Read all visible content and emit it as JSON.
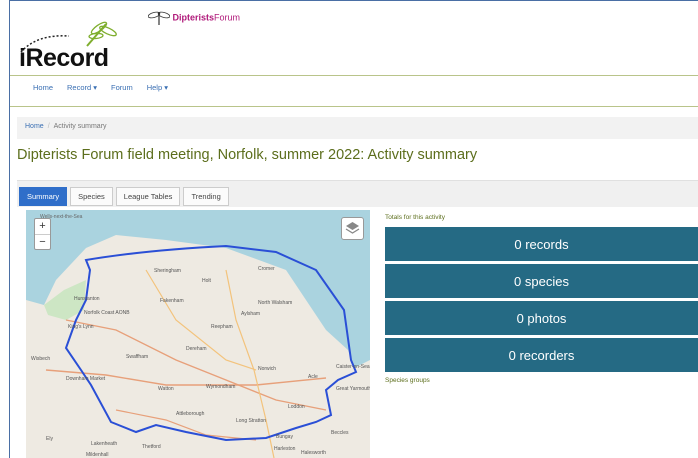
{
  "header": {
    "logo_text": "iRecord",
    "partner_name_bold": "Dipterists",
    "partner_name_rest": "Forum"
  },
  "nav": {
    "items": [
      "Home",
      "Record ▾",
      "Forum",
      "Help ▾"
    ]
  },
  "breadcrumb": {
    "home": "Home",
    "separator": "/",
    "current": "Activity summary"
  },
  "page": {
    "title": "Dipterists Forum field meeting, Norfolk, summer 2022: Activity summary"
  },
  "tabs": [
    {
      "label": "Summary",
      "active": true
    },
    {
      "label": "Species",
      "active": false
    },
    {
      "label": "League Tables",
      "active": false
    },
    {
      "label": "Trending",
      "active": false
    }
  ],
  "map": {
    "zoom_in": "+",
    "zoom_out": "−",
    "boundary_color": "#2a4fd6",
    "place_labels": [
      "Wells-next-the-Sea",
      "Sheringham",
      "Cromer",
      "Hunstanton",
      "Norfolk Coast AONB",
      "Fakenham",
      "North Walsham",
      "Aylsham",
      "King's Lynn",
      "Reepham",
      "Dereham",
      "Swaffham",
      "Norwich",
      "Caister-on-Sea",
      "Great Yarmouth",
      "Downham Market",
      "Watton",
      "Wymondham",
      "Loddon",
      "Attleborough",
      "Long Stratton",
      "Lakenheath",
      "Thetford",
      "Bungay",
      "Beccles",
      "Halesworth",
      "Mildenhall",
      "Harleston",
      "Acle",
      "Holt",
      "Ely",
      "Wisbech"
    ]
  },
  "stats": {
    "totals_label": "Totals for this activity",
    "records": "0 records",
    "species": "0 species",
    "photos": "0 photos",
    "recorders": "0 recorders",
    "groups_label": "Species groups",
    "panel_color": "#256a84"
  }
}
